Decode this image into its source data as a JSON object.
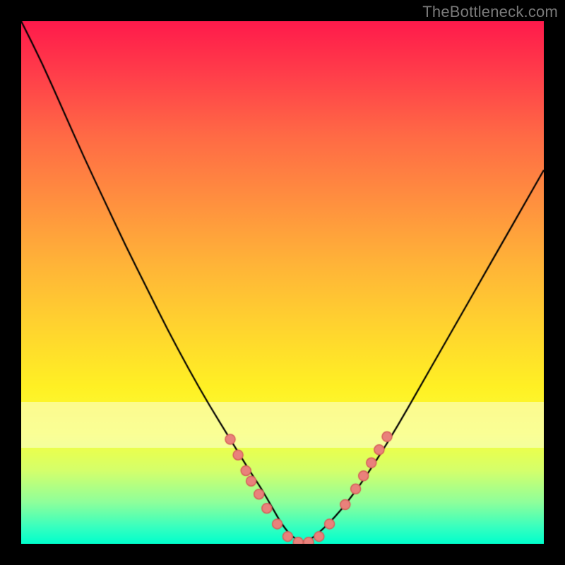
{
  "attribution": "TheBottleneck.com",
  "colors": {
    "page_background": "#000000",
    "gradient_top": "#ff1a4b",
    "gradient_bottom": "#00ffcc",
    "curve": "#000000",
    "marker_fill": "#e9817b",
    "marker_stroke": "#d65f5a",
    "pale_band": "#fbffe0",
    "attribution_text": "#7a7a7a"
  },
  "layout": {
    "canvas_size": 800,
    "plot_inset": 30,
    "pale_band_top_frac": 0.728,
    "pale_band_height_frac": 0.088
  },
  "chart_data": {
    "type": "line",
    "title": "",
    "xlabel": "",
    "ylabel": "",
    "xlim": [
      0,
      100
    ],
    "ylim": [
      0,
      100
    ],
    "grid": false,
    "legend": false,
    "series": [
      {
        "name": "bottleneck-curve",
        "x": [
          0,
          4,
          8,
          12,
          16,
          20,
          24,
          28,
          32,
          36,
          40,
          44,
          46,
          48,
          50,
          52,
          54,
          56,
          60,
          64,
          68,
          72,
          76,
          80,
          84,
          88,
          92,
          96,
          100
        ],
        "y": [
          100,
          92,
          83,
          74,
          65.5,
          57,
          49,
          41,
          33.5,
          26.5,
          20,
          13.5,
          10.5,
          7,
          3.5,
          1.2,
          0.2,
          1.2,
          5,
          10,
          16,
          22.5,
          29.5,
          36.5,
          43.5,
          50.5,
          57.5,
          64.5,
          71.5
        ]
      }
    ],
    "markers": {
      "name": "highlight-dots",
      "points": [
        {
          "x": 40.0,
          "y": 20.0
        },
        {
          "x": 41.5,
          "y": 17.0
        },
        {
          "x": 43.0,
          "y": 14.0
        },
        {
          "x": 44.0,
          "y": 12.0
        },
        {
          "x": 45.5,
          "y": 9.5
        },
        {
          "x": 47.0,
          "y": 6.8
        },
        {
          "x": 49.0,
          "y": 3.8
        },
        {
          "x": 51.0,
          "y": 1.4
        },
        {
          "x": 53.0,
          "y": 0.3
        },
        {
          "x": 55.0,
          "y": 0.3
        },
        {
          "x": 57.0,
          "y": 1.4
        },
        {
          "x": 59.0,
          "y": 3.8
        },
        {
          "x": 62.0,
          "y": 7.5
        },
        {
          "x": 64.0,
          "y": 10.5
        },
        {
          "x": 65.5,
          "y": 13.0
        },
        {
          "x": 67.0,
          "y": 15.5
        },
        {
          "x": 68.5,
          "y": 18.0
        },
        {
          "x": 70.0,
          "y": 20.5
        }
      ],
      "radius": 7
    }
  }
}
